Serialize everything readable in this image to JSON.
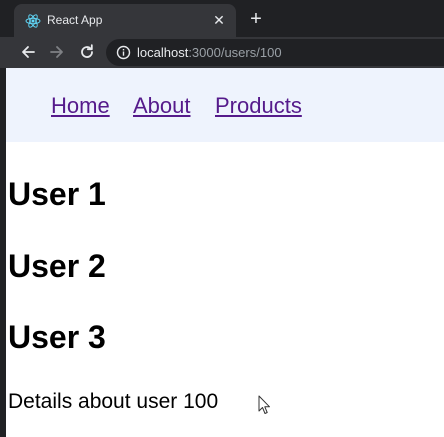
{
  "browser": {
    "tab": {
      "title": "React App",
      "favicon": "react-logo-icon"
    },
    "new_tab_symbol": "+",
    "close_symbol": "✕",
    "url_host": "localhost",
    "url_rest": ":3000/users/100"
  },
  "nav": {
    "links": [
      "Home",
      "About",
      "Products"
    ],
    "link_color": "#551a8b",
    "background": "#eef3fd"
  },
  "users": [
    "User 1",
    "User 2",
    "User 3"
  ],
  "details": "Details about user 100"
}
